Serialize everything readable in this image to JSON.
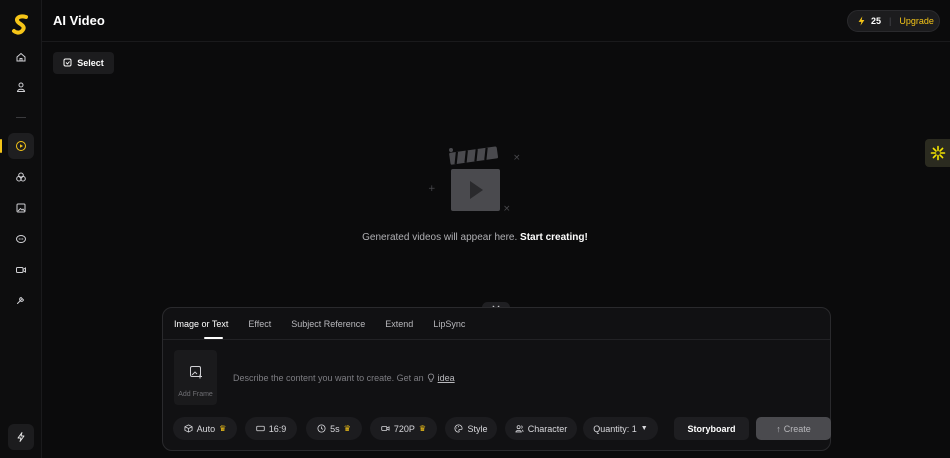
{
  "app": {
    "title": "AI Video"
  },
  "credits": {
    "count": "25",
    "separator": "|",
    "upgrade_label": "Upgrade"
  },
  "toolbar": {
    "select_label": "Select"
  },
  "empty_state": {
    "text": "Generated videos will appear here.",
    "cta": "Start creating!"
  },
  "composer": {
    "tabs": [
      {
        "label": "Image or Text",
        "active": true
      },
      {
        "label": "Effect"
      },
      {
        "label": "Subject Reference"
      },
      {
        "label": "Extend"
      },
      {
        "label": "LipSync"
      }
    ],
    "add_frame_label": "Add Frame",
    "prompt_placeholder": "Describe the content you want to create. Get an",
    "idea_link": "idea",
    "options": {
      "model": "Auto",
      "aspect_ratio": "16:9",
      "duration": "5s",
      "resolution": "720P",
      "style": "Style",
      "character": "Character",
      "quantity": "Quantity: 1"
    },
    "storyboard_label": "Storyboard",
    "create_label": "Create"
  },
  "colors": {
    "accent": "#f5c518",
    "background": "#0b0b0c",
    "panel": "#111113"
  },
  "sidebar": {
    "icons": [
      "home-icon",
      "user-icon",
      "video-icon",
      "effects-icon",
      "image-icon",
      "chat-icon",
      "camera-icon",
      "tools-icon",
      "bolt-icon"
    ],
    "active": "video-icon"
  }
}
